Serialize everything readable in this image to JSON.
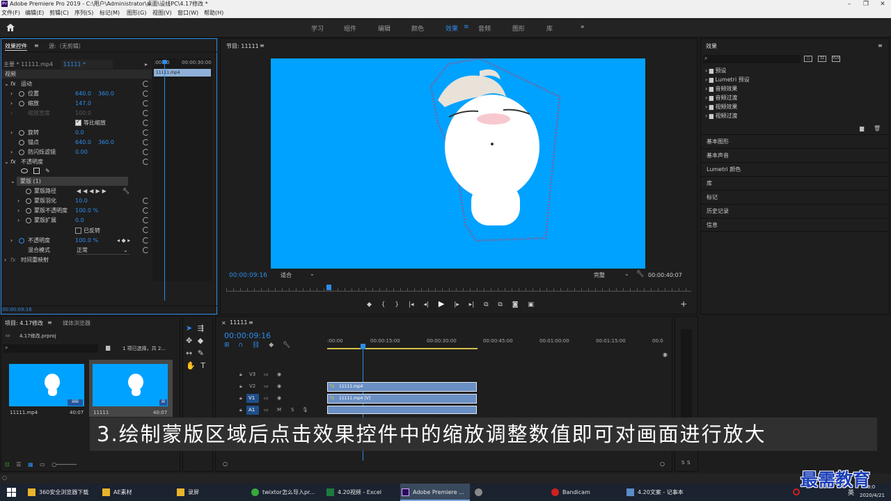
{
  "window": {
    "title": "Adobe Premiere Pro 2019 - C:\\用户\\Administrator\\桌面\\设线PC\\4.17修改 *",
    "icon": "Pr"
  },
  "menu": [
    "文件(F)",
    "编辑(E)",
    "剪辑(C)",
    "序列(S)",
    "标记(M)",
    "图形(G)",
    "视图(V)",
    "窗口(W)",
    "帮助(H)"
  ],
  "workspaces": {
    "items": [
      "学习",
      "组件",
      "编辑",
      "颜色",
      "效果",
      "音频",
      "图形",
      "库"
    ],
    "active": "效果",
    "more": "»",
    "menu_icon": "≡"
  },
  "effect_controls": {
    "tab_label": "效果控件",
    "tab_menu": "≡",
    "source_tab": "源:（无剪辑）",
    "master": "主要 * 11111.mp4",
    "clip": "11111 * 11111.mp4",
    "ruler_start": ":00:00",
    "ruler_end": "00:00:30:00",
    "clip_bar": "11111.mp4",
    "section_video": "视频",
    "motion": {
      "label": "运动",
      "fx": "fx"
    },
    "position": {
      "label": "位置",
      "x": "640.0",
      "y": "360.0"
    },
    "scale": {
      "label": "缩放",
      "value": "147.0"
    },
    "scale_width": {
      "label": "缩放宽度",
      "value": "100.0"
    },
    "uniform_scale": {
      "label": "等比缩放"
    },
    "rotation": {
      "label": "旋转",
      "value": "0.0"
    },
    "anchor": {
      "label": "锚点",
      "x": "640.0",
      "y": "360.0"
    },
    "flicker": {
      "label": "防闪烁滤镜",
      "value": "0.00"
    },
    "opacity_section": {
      "label": "不透明度",
      "fx": "fx"
    },
    "mask": {
      "label": "蒙版 (1)"
    },
    "mask_path": {
      "label": "蒙版路径"
    },
    "mask_feather": {
      "label": "蒙版羽化",
      "value": "10.0"
    },
    "mask_opacity": {
      "label": "蒙版不透明度",
      "value": "100.0 %"
    },
    "mask_expansion": {
      "label": "蒙版扩展",
      "value": "0.0"
    },
    "inverted": {
      "label": "已反转"
    },
    "opacity": {
      "label": "不透明度",
      "value": "100.0 %"
    },
    "blend": {
      "label": "混合模式",
      "value": "正常"
    },
    "time_remap": {
      "label": "时间重映射",
      "fx": "fx"
    },
    "timecode": "00:00:09:16"
  },
  "program_monitor": {
    "title": "节目: 11111",
    "menu": "≡",
    "timecode": "00:00:09:16",
    "fit": "适合",
    "quality": "完整",
    "duration": "00:00:40:07",
    "playhead_fraction": 0.22
  },
  "effects_panel": {
    "title": "效果",
    "menu": "≡",
    "folders": [
      "预设",
      "Lumetri 预设",
      "音频效果",
      "音频过渡",
      "视频效果",
      "视频过渡"
    ],
    "sections": [
      "基本图形",
      "基本声音",
      "Lumetri 颜色",
      "库",
      "标记",
      "历史记录",
      "信息"
    ],
    "toolbar_icons": [
      "accelerate-icon",
      "32bit-icon",
      "yuv-icon"
    ]
  },
  "project_panel": {
    "tab_label": "项目: 4.17修改",
    "tab_menu": "≡",
    "browser_tab": "媒体浏览器",
    "file": "4.17修改.prproj",
    "selection": "1 项已选择，共 2...",
    "items": [
      {
        "name": "11111.mp4",
        "duration": "40:07"
      },
      {
        "name": "11111",
        "duration": "40:07"
      }
    ]
  },
  "timeline": {
    "tab_label": "11111",
    "tab_menu": "≡",
    "timecode": "00:00:09:16",
    "ruler": [
      ":00:00",
      "00:00:15:00",
      "00:00:30:00",
      "00:00:45:00",
      "00:01:00:00",
      "00:01:15:00",
      "00:0"
    ],
    "tracks": [
      "V3",
      "V2",
      "V1",
      "A1"
    ],
    "clips": [
      {
        "track": "V2",
        "label": "11111.mp4"
      },
      {
        "track": "V1",
        "label": "11111.mp4 [V]"
      }
    ],
    "playhead_fraction": 0.105
  },
  "meter": {
    "labels": [
      "S",
      "S"
    ]
  },
  "subtitle": "3.绘制蒙版区域后点击效果控件中的缩放调整数值即可对画面进行放大",
  "watermark": "最需教育",
  "taskbar": {
    "items": [
      {
        "label": "360安全浏览器下载",
        "color": "#e7b42a"
      },
      {
        "label": "AE素材",
        "color": "#e7b42a"
      },
      {
        "label": "录屏",
        "color": "#e7b42a"
      },
      {
        "label": "twixtor怎么导入pr...",
        "color": "#3aa83a"
      },
      {
        "label": "4.20视频 - Excel",
        "color": "#1e7a3c"
      },
      {
        "label": "Adobe Premiere ...",
        "color": "#2a0a5a"
      },
      {
        "label": "",
        "color": "#888888"
      },
      {
        "label": "Bandicam",
        "color": "#d02020"
      },
      {
        "label": "4.20文案 - 记事本",
        "color": "#5a8cc8"
      }
    ],
    "active": "Adobe Premiere ...",
    "ime": "英",
    "clock_time": "8:0",
    "clock_date": "2020/4/21"
  },
  "colors": {
    "accent": "#2d8ceb",
    "canvas": "#00a2ff",
    "clip": "#6a8fc4"
  }
}
